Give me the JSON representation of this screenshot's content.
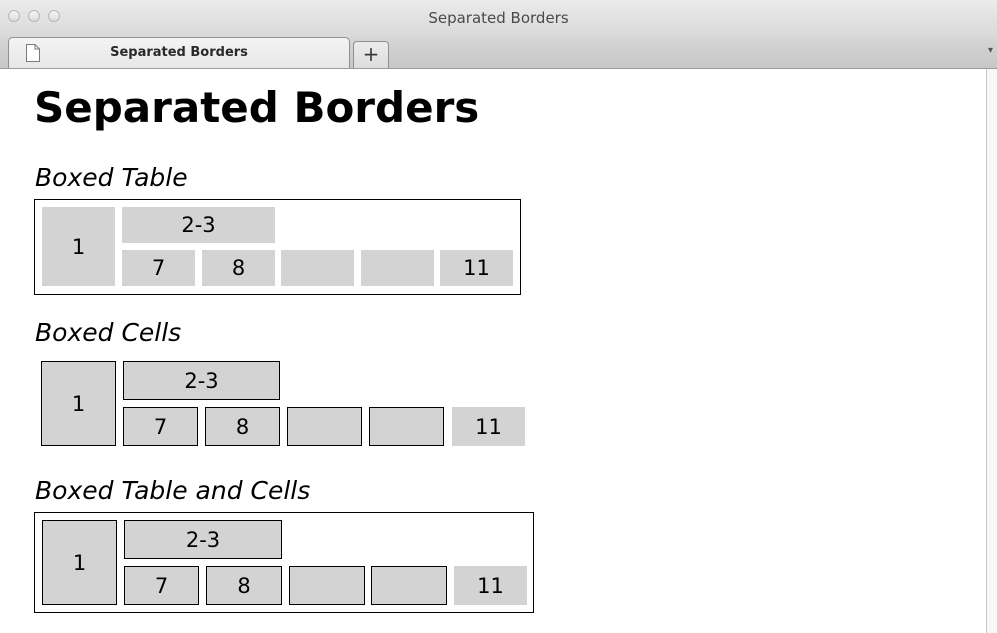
{
  "window": {
    "title": "Separated Borders"
  },
  "tabs": {
    "active_label": "Separated Borders",
    "new_tab_label": "+",
    "menu_glyph": "▾"
  },
  "page": {
    "heading": "Separated Borders"
  },
  "sections": [
    {
      "title": "Boxed Table",
      "cells": {
        "c1": "1",
        "c23": "2-3",
        "c7": "7",
        "c8": "8",
        "c9": "",
        "c10": "",
        "c11": "11"
      }
    },
    {
      "title": "Boxed Cells",
      "cells": {
        "c1": "1",
        "c23": "2-3",
        "c7": "7",
        "c8": "8",
        "c9": "",
        "c10": "",
        "c11": "11"
      }
    },
    {
      "title": "Boxed Table and Cells",
      "cells": {
        "c1": "1",
        "c23": "2-3",
        "c7": "7",
        "c8": "8",
        "c9": "",
        "c10": "",
        "c11": "11"
      }
    }
  ],
  "colors": {
    "cell_background": "#d3d3d3",
    "border": "#000000",
    "chrome": "#d8d8d8"
  },
  "icons": {
    "tab_icon": "document-icon"
  }
}
